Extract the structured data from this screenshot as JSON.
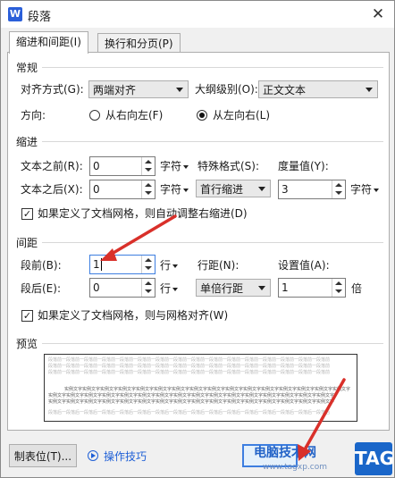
{
  "window": {
    "title": "段落",
    "logo": "W",
    "close": "✕"
  },
  "tabs": [
    {
      "label": "缩进和间距(I)"
    },
    {
      "label": "换行和分页(P)"
    }
  ],
  "general": {
    "title": "常规",
    "alignment_label": "对齐方式(G):",
    "alignment_value": "两端对齐",
    "outline_label": "大纲级别(O):",
    "outline_value": "正文文本",
    "direction_label": "方向:",
    "rtl_label": "从右向左(F)",
    "ltr_label": "从左向右(L)"
  },
  "indent": {
    "title": "缩进",
    "before_label": "文本之前(R):",
    "before_value": "0",
    "before_unit": "字符",
    "after_label": "文本之后(X):",
    "after_value": "0",
    "after_unit": "字符",
    "special_label": "特殊格式(S):",
    "special_value": "首行缩进",
    "measure_label": "度量值(Y):",
    "measure_value": "3",
    "measure_unit": "字符",
    "auto_adjust_label": "如果定义了文档网格，则自动调整右缩进(D)"
  },
  "spacing": {
    "title": "间距",
    "before_label": "段前(B):",
    "before_value": "1",
    "before_unit": "行",
    "after_label": "段后(E):",
    "after_value": "0",
    "after_unit": "行",
    "line_label": "行距(N):",
    "line_value": "单倍行距",
    "setting_label": "设置值(A):",
    "setting_value": "1",
    "setting_unit": "倍",
    "grid_align_label": "如果定义了文档网格，则与网格对齐(W)"
  },
  "preview": {
    "title": "预览",
    "prev_text": "段落前一段落前一段落前一段落前一段落前一段落前一段落前一段落前一段落前一段落前一段落前一段落前一段落前一段落前一段落前一段落前",
    "sample_text": "实例文字实例文字实例文字实例文字实例文字实例文字实例文字实例文字实例文字实例文字实例文字实例文字实例文字实例文字实例文字实例文字",
    "next_text": "段落后一段落后一段落后一段落后一段落后一段落后一段落后一段落后一段落后一段落后一段落后一段落后一段落后一段落后一段落后一段落后"
  },
  "footer": {
    "tab_button": "制表位(T)...",
    "tips_label": "操作技巧"
  },
  "watermark": {
    "site_name": "电脑技术网",
    "url": "www.tagxp.com",
    "tag": "TAG"
  },
  "colors": {
    "accent": "#1e5fd6",
    "arrow": "#d9302a",
    "tag_bg": "#1a66c9"
  }
}
